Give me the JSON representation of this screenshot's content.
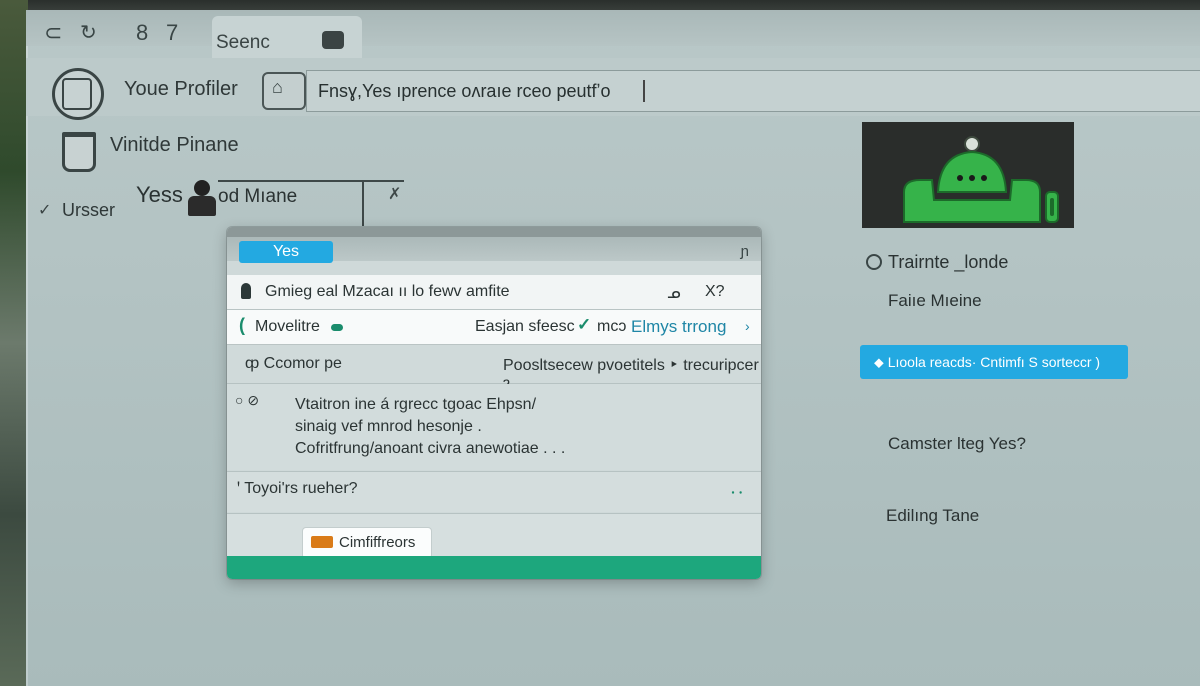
{
  "colors": {
    "accent": "#23a9e1",
    "success": "#1da77d",
    "android_green": "#36b34a",
    "card_bg": "#2a2d2b",
    "orange": "#d97b18"
  },
  "toolbar": {
    "back_glyph": "⊂",
    "refresh_glyph": "↻",
    "nav_item_1": "8",
    "nav_item_2": "7",
    "tab_label": "Seenc",
    "tab_icon": "window-icon"
  },
  "address": {
    "profile_label": "Youe Profiler",
    "button_glyph": "⌂",
    "value": "Fnsɣ,Yes ıprence oʌraıe rceo peutfʼo"
  },
  "left": {
    "section_title": "Vinitde Pinane",
    "user_label": "Ursser",
    "yes_label": "Yess",
    "name_label": "od Mıane",
    "x_mark": "✗"
  },
  "dialog": {
    "yes_pill": "Yes",
    "close_glyph": "ɲ",
    "search_row": {
      "text": "Gmieg eal  Mzacaı  ıı    lo fewv amfite",
      "mid": "ᓄ",
      "end": "X?"
    },
    "move_row": {
      "arrow": "(",
      "label": "Movelitre",
      "right_text": "Easjan sfeesc",
      "check": "✓",
      "right_text_2": "mcɔ",
      "link": "Elmys trrong",
      "chevron": "›"
    },
    "common_row": {
      "left": "ȹ Ccomor pe",
      "right": "Poosltsecew pvoetitels ‣ trecuripcer ȝ"
    },
    "body": {
      "radio": "○ ⊘",
      "lines": [
        "Vtaitron ine á rgrecc tgoac Ehpsn/",
        "sinaig vef mnrod hesonje .",
        "Cofritfrung/anoant civra anewotiae . . ."
      ]
    },
    "question": {
      "text": "ꞌ   Toyoi'rs rueher?",
      "dots": "ꞏ ꞏ"
    },
    "footer_button": "Cimfiffreors"
  },
  "right": {
    "title": "Trairnte _londe",
    "subtitle": "Faiıe Mıeine",
    "blue_button": "⬥  Lıoola  reacds·  Cntimfı S sorteccr )",
    "question": "Camster lteg Yes?",
    "editing": "Edilıng Tane"
  }
}
